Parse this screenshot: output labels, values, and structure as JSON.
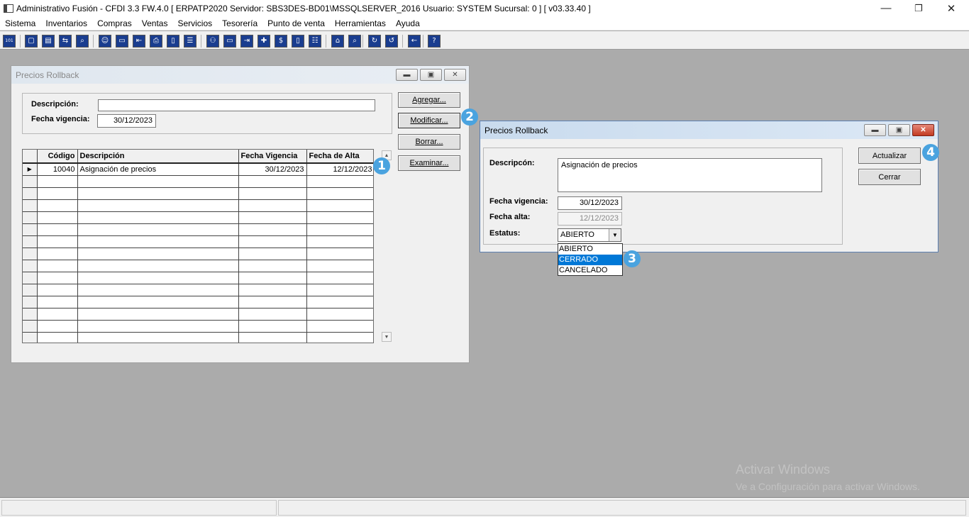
{
  "app": {
    "title": "Administrativo Fusión - CFDI 3.3 FW.4.0 [ ERPATP2020   Servidor: SBS3DES-BD01\\MSSQLSERVER_2016   Usuario: SYSTEM     Sucursal: 0 ] [ v03.33.40 ]",
    "minimize": "—",
    "maximize": "❐",
    "close": "✕"
  },
  "menu": [
    "Sistema",
    "Inventarios",
    "Compras",
    "Ventas",
    "Servicios",
    "Tesorería",
    "Punto de venta",
    "Herramientas",
    "Ayuda"
  ],
  "toolbar": {
    "icons": [
      "ledger-icon",
      "copy-icon",
      "paste-icon",
      "transfer-icon",
      "search-doc-icon",
      "user-icon",
      "folder-icon",
      "import-icon",
      "printer-icon",
      "document-icon",
      "list-icon",
      "binoculars-icon",
      "window-icon",
      "export-icon",
      "add-icon",
      "money-icon",
      "report-icon",
      "table-icon",
      "home-icon",
      "zoom-icon",
      "refresh-icon",
      "undo-icon",
      "back-icon",
      "help-icon"
    ],
    "glyphs": [
      "101",
      "▢",
      "▤",
      "⇆",
      "⌕",
      "☺",
      "▭",
      "⇤",
      "⎙",
      "▯",
      "☰",
      "⚇",
      "▭",
      "⇥",
      "✚",
      "$",
      "▯",
      "☷",
      "⌂",
      "⌕",
      "↻",
      "↺",
      "←",
      "?"
    ]
  },
  "win1": {
    "title": "Precios Rollback",
    "labels": {
      "descripcion": "Descripción:",
      "fecha_vigencia": "Fecha vigencia:"
    },
    "fields": {
      "descripcion": "",
      "fecha_vigencia": "30/12/2023"
    },
    "buttons": {
      "agregar": "Agregar...",
      "modificar": "Modificar...",
      "borrar": "Borrar...",
      "examinar": "Examinar..."
    },
    "grid": {
      "columns": [
        "Código",
        "Descripción",
        "Fecha Vigencia",
        "Fecha de Alta"
      ],
      "rows": [
        {
          "indicator": "▶",
          "codigo": "10040",
          "descripcion": "Asignación de precios",
          "fecha_vigencia": "30/12/2023",
          "fecha_alta": "12/12/2023"
        }
      ]
    }
  },
  "win2": {
    "title": "Precios Rollback",
    "labels": {
      "descripcion": "Descripcón:",
      "fecha_vigencia": "Fecha vigencia:",
      "fecha_alta": "Fecha alta:",
      "estatus": "Estatus:"
    },
    "fields": {
      "descripcion": "Asignación de precios",
      "fecha_vigencia": "30/12/2023",
      "fecha_alta": "12/12/2023",
      "estatus": "ABIERTO"
    },
    "estatus_options": [
      "ABIERTO",
      "CERRADO",
      "CANCELADO"
    ],
    "estatus_highlighted": "CERRADO",
    "buttons": {
      "actualizar": "Actualizar",
      "cerrar": "Cerrar"
    }
  },
  "callouts": [
    "1",
    "2",
    "3",
    "4"
  ],
  "watermark": {
    "line1": "Activar Windows",
    "line2": "Ve a Configuración para activar Windows."
  }
}
